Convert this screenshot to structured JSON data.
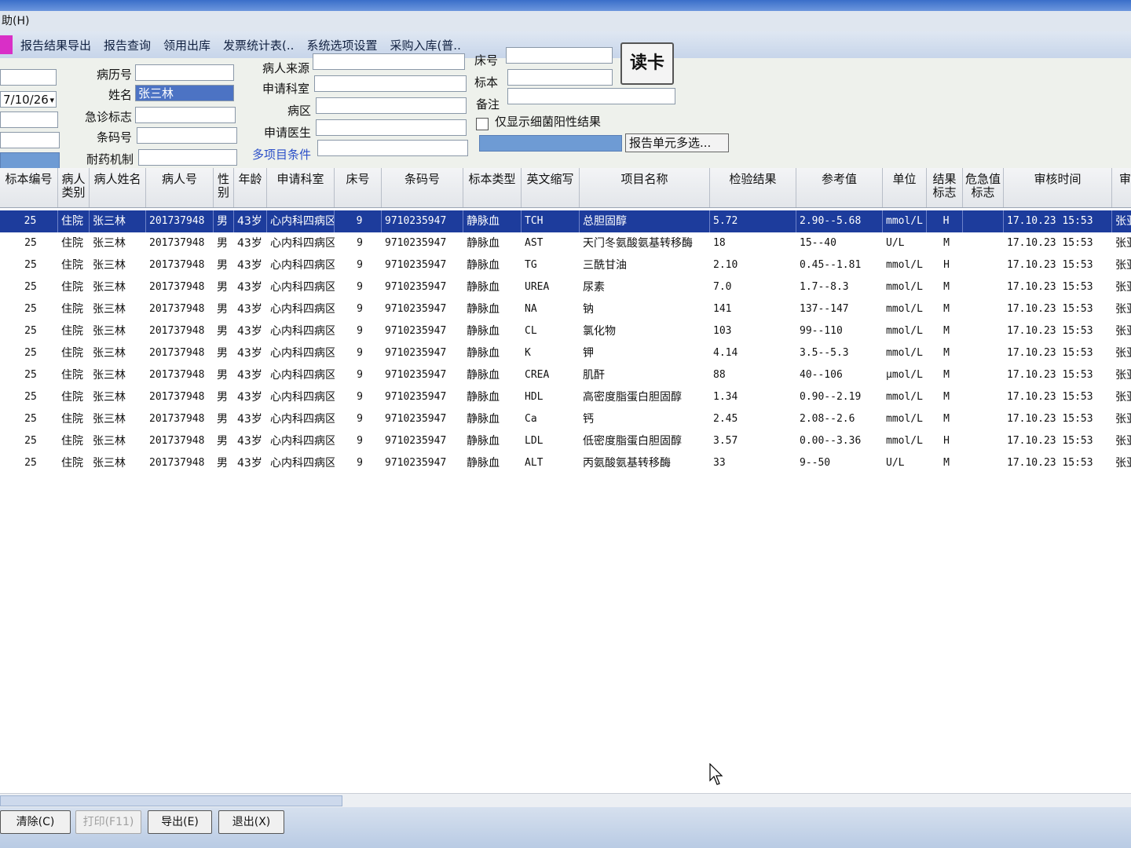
{
  "menubar": {
    "help": "助(H)"
  },
  "toolbar": {
    "items": [
      "报告结果导出",
      "报告查询",
      "领用出库",
      "发票统计表(..",
      "系统选项设置",
      "采购入库(普.."
    ]
  },
  "form": {
    "date_value": "7/10/26",
    "labels": {
      "medical_record_no": "病历号",
      "name": "姓名",
      "emergency_flag": "急诊标志",
      "barcode": "条码号",
      "drug_resistance": "耐药机制",
      "patient_source": "病人来源",
      "request_dept": "申请科室",
      "ward": "病区",
      "request_doctor": "申请医生",
      "multi_condition": "多项目条件",
      "bed_no": "床号",
      "specimen": "标本",
      "remark": "备注",
      "bacteria_only": "仅显示细菌阳性结果"
    },
    "name_value": "张三林",
    "read_card": "读卡",
    "multi_select": "报告单元多选..."
  },
  "table": {
    "columns": [
      "标本编号",
      "病人类别",
      "病人姓名",
      "病人号",
      "性别",
      "年龄",
      "申请科室",
      "床号",
      "条码号",
      "标本类型",
      "英文缩写",
      "项目名称",
      "检验结果",
      "参考值",
      "单位",
      "结果标志",
      "危急值标志",
      "审核时间",
      "审"
    ],
    "rows": [
      [
        "25",
        "住院",
        "张三林",
        "201737948",
        "男",
        "43岁",
        "心内科四病区",
        "9",
        "9710235947",
        "静脉血",
        "TCH",
        "总胆固醇",
        "5.72",
        "2.90--5.68",
        "mmol/L",
        "H",
        "",
        "17.10.23 15:53",
        "张亚"
      ],
      [
        "25",
        "住院",
        "张三林",
        "201737948",
        "男",
        "43岁",
        "心内科四病区",
        "9",
        "9710235947",
        "静脉血",
        "AST",
        "天门冬氨酸氨基转移酶",
        "18",
        "15--40",
        "U/L",
        "M",
        "",
        "17.10.23 15:53",
        "张亚"
      ],
      [
        "25",
        "住院",
        "张三林",
        "201737948",
        "男",
        "43岁",
        "心内科四病区",
        "9",
        "9710235947",
        "静脉血",
        "TG",
        "三酰甘油",
        "2.10",
        "0.45--1.81",
        "mmol/L",
        "H",
        "",
        "17.10.23 15:53",
        "张亚"
      ],
      [
        "25",
        "住院",
        "张三林",
        "201737948",
        "男",
        "43岁",
        "心内科四病区",
        "9",
        "9710235947",
        "静脉血",
        "UREA",
        "尿素",
        "7.0",
        "1.7--8.3",
        "mmol/L",
        "M",
        "",
        "17.10.23 15:53",
        "张亚"
      ],
      [
        "25",
        "住院",
        "张三林",
        "201737948",
        "男",
        "43岁",
        "心内科四病区",
        "9",
        "9710235947",
        "静脉血",
        "NA",
        "钠",
        "141",
        "137--147",
        "mmol/L",
        "M",
        "",
        "17.10.23 15:53",
        "张亚"
      ],
      [
        "25",
        "住院",
        "张三林",
        "201737948",
        "男",
        "43岁",
        "心内科四病区",
        "9",
        "9710235947",
        "静脉血",
        "CL",
        "氯化物",
        "103",
        "99--110",
        "mmol/L",
        "M",
        "",
        "17.10.23 15:53",
        "张亚"
      ],
      [
        "25",
        "住院",
        "张三林",
        "201737948",
        "男",
        "43岁",
        "心内科四病区",
        "9",
        "9710235947",
        "静脉血",
        "K",
        "钾",
        "4.14",
        "3.5--5.3",
        "mmol/L",
        "M",
        "",
        "17.10.23 15:53",
        "张亚"
      ],
      [
        "25",
        "住院",
        "张三林",
        "201737948",
        "男",
        "43岁",
        "心内科四病区",
        "9",
        "9710235947",
        "静脉血",
        "CREA",
        "肌酐",
        "88",
        "40--106",
        "μmol/L",
        "M",
        "",
        "17.10.23 15:53",
        "张亚"
      ],
      [
        "25",
        "住院",
        "张三林",
        "201737948",
        "男",
        "43岁",
        "心内科四病区",
        "9",
        "9710235947",
        "静脉血",
        "HDL",
        "高密度脂蛋白胆固醇",
        "1.34",
        "0.90--2.19",
        "mmol/L",
        "M",
        "",
        "17.10.23 15:53",
        "张亚"
      ],
      [
        "25",
        "住院",
        "张三林",
        "201737948",
        "男",
        "43岁",
        "心内科四病区",
        "9",
        "9710235947",
        "静脉血",
        "Ca",
        "钙",
        "2.45",
        "2.08--2.6",
        "mmol/L",
        "M",
        "",
        "17.10.23 15:53",
        "张亚"
      ],
      [
        "25",
        "住院",
        "张三林",
        "201737948",
        "男",
        "43岁",
        "心内科四病区",
        "9",
        "9710235947",
        "静脉血",
        "LDL",
        "低密度脂蛋白胆固醇",
        "3.57",
        "0.00--3.36",
        "mmol/L",
        "H",
        "",
        "17.10.23 15:53",
        "张亚"
      ],
      [
        "25",
        "住院",
        "张三林",
        "201737948",
        "男",
        "43岁",
        "心内科四病区",
        "9",
        "9710235947",
        "静脉血",
        "ALT",
        "丙氨酸氨基转移酶",
        "33",
        "9--50",
        "U/L",
        "M",
        "",
        "17.10.23 15:53",
        "张亚"
      ]
    ]
  },
  "footer": {
    "clear": "清除(C)",
    "print": "打印(F11)",
    "export": "导出(E)",
    "exit": "退出(X)"
  }
}
